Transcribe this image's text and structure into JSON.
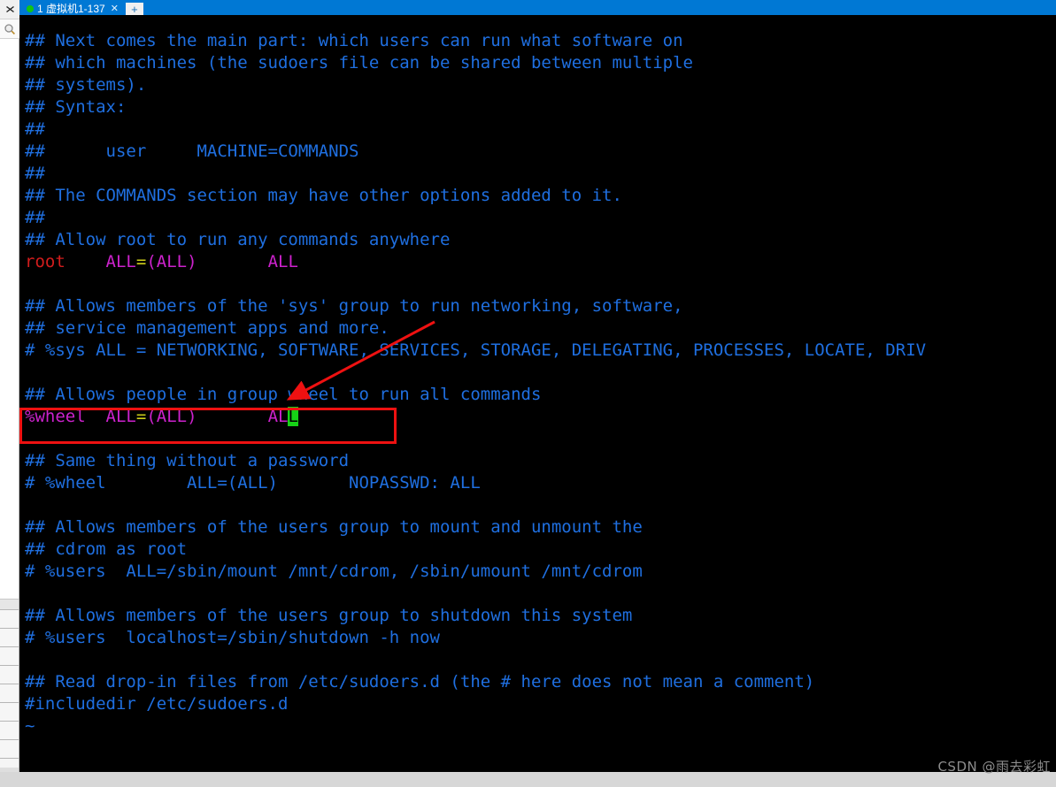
{
  "window": {
    "tab": {
      "title": "1 虚拟机1-137",
      "close_label": "✕",
      "status_dot_color": "#13c513"
    },
    "new_tab_label": "+",
    "tabbar_color": "#0078d4"
  },
  "sidebar": {
    "close_icon_label": "✕",
    "search_icon_label": "search-icon",
    "list_rows": 8
  },
  "terminal": {
    "background": "#000000",
    "colors": {
      "comment": "#1f6fe0",
      "user": "#d21d1d",
      "alias": "#cc22cc",
      "operator": "#cfcf1a",
      "cursor_bg": "#16d216"
    },
    "lines": [
      {
        "id": "l01",
        "segments": [
          {
            "t": "## Next comes the main part: which users can run what software on",
            "c": "comment"
          }
        ]
      },
      {
        "id": "l02",
        "segments": [
          {
            "t": "## which machines (the sudoers file can be shared between multiple",
            "c": "comment"
          }
        ]
      },
      {
        "id": "l03",
        "segments": [
          {
            "t": "## systems).",
            "c": "comment"
          }
        ]
      },
      {
        "id": "l04",
        "segments": [
          {
            "t": "## Syntax:",
            "c": "comment"
          }
        ]
      },
      {
        "id": "l05",
        "segments": [
          {
            "t": "##",
            "c": "comment"
          }
        ]
      },
      {
        "id": "l06",
        "segments": [
          {
            "t": "##      user     MACHINE=COMMANDS",
            "c": "comment"
          }
        ]
      },
      {
        "id": "l07",
        "segments": [
          {
            "t": "##",
            "c": "comment"
          }
        ]
      },
      {
        "id": "l08",
        "segments": [
          {
            "t": "## The COMMANDS section may have other options added to it.",
            "c": "comment"
          }
        ]
      },
      {
        "id": "l09",
        "segments": [
          {
            "t": "##",
            "c": "comment"
          }
        ]
      },
      {
        "id": "l10",
        "segments": [
          {
            "t": "## Allow root to run any commands anywhere",
            "c": "comment"
          }
        ]
      },
      {
        "id": "l11",
        "segments": [
          {
            "t": "root",
            "c": "user"
          },
          {
            "t": "    ",
            "c": "plain"
          },
          {
            "t": "ALL",
            "c": "alias"
          },
          {
            "t": "=",
            "c": "operator"
          },
          {
            "t": "(ALL)",
            "c": "alias"
          },
          {
            "t": "       ",
            "c": "plain"
          },
          {
            "t": "ALL",
            "c": "alias"
          }
        ]
      },
      {
        "id": "l12",
        "segments": [
          {
            "t": "",
            "c": "plain"
          }
        ]
      },
      {
        "id": "l13",
        "segments": [
          {
            "t": "## Allows members of the 'sys' group to run networking, software,",
            "c": "comment"
          }
        ]
      },
      {
        "id": "l14",
        "segments": [
          {
            "t": "## service management apps and more.",
            "c": "comment"
          }
        ]
      },
      {
        "id": "l15",
        "segments": [
          {
            "t": "# %sys ALL = NETWORKING, SOFTWARE, SERVICES, STORAGE, DELEGATING, PROCESSES, LOCATE, DRIV",
            "c": "comment"
          }
        ]
      },
      {
        "id": "l16",
        "segments": [
          {
            "t": "",
            "c": "plain"
          }
        ]
      },
      {
        "id": "l17",
        "segments": [
          {
            "t": "## Allows people in group wheel to run all commands",
            "c": "comment"
          }
        ]
      },
      {
        "id": "l18",
        "segments": [
          {
            "t": "%wheel",
            "c": "alias"
          },
          {
            "t": "  ",
            "c": "plain"
          },
          {
            "t": "ALL",
            "c": "alias"
          },
          {
            "t": "=",
            "c": "operator"
          },
          {
            "t": "(ALL)",
            "c": "alias"
          },
          {
            "t": "       ",
            "c": "plain"
          },
          {
            "t": "AL",
            "c": "alias"
          },
          {
            "t": "L",
            "c": "cursor"
          }
        ]
      },
      {
        "id": "l19",
        "segments": [
          {
            "t": "",
            "c": "plain"
          }
        ]
      },
      {
        "id": "l20",
        "segments": [
          {
            "t": "## Same thing without a password",
            "c": "comment"
          }
        ]
      },
      {
        "id": "l21",
        "segments": [
          {
            "t": "# %wheel        ALL=(ALL)       NOPASSWD: ALL",
            "c": "comment"
          }
        ]
      },
      {
        "id": "l22",
        "segments": [
          {
            "t": "",
            "c": "plain"
          }
        ]
      },
      {
        "id": "l23",
        "segments": [
          {
            "t": "## Allows members of the users group to mount and unmount the",
            "c": "comment"
          }
        ]
      },
      {
        "id": "l24",
        "segments": [
          {
            "t": "## cdrom as root",
            "c": "comment"
          }
        ]
      },
      {
        "id": "l25",
        "segments": [
          {
            "t": "# %users  ALL=/sbin/mount /mnt/cdrom, /sbin/umount /mnt/cdrom",
            "c": "comment"
          }
        ]
      },
      {
        "id": "l26",
        "segments": [
          {
            "t": "",
            "c": "plain"
          }
        ]
      },
      {
        "id": "l27",
        "segments": [
          {
            "t": "## Allows members of the users group to shutdown this system",
            "c": "comment"
          }
        ]
      },
      {
        "id": "l28",
        "segments": [
          {
            "t": "# %users  localhost=/sbin/shutdown -h now",
            "c": "comment"
          }
        ]
      },
      {
        "id": "l29",
        "segments": [
          {
            "t": "",
            "c": "plain"
          }
        ]
      },
      {
        "id": "l30",
        "segments": [
          {
            "t": "## Read drop-in files from /etc/sudoers.d (the # here does not mean a comment)",
            "c": "comment"
          }
        ]
      },
      {
        "id": "l31",
        "segments": [
          {
            "t": "#includedir /etc/sudoers.d",
            "c": "comment"
          }
        ]
      },
      {
        "id": "l32",
        "segments": [
          {
            "t": "~",
            "c": "comment"
          }
        ]
      }
    ]
  },
  "annotations": {
    "highlight_box": {
      "name": "wheel-line-highlight-box",
      "color": "#ee1111",
      "target_text": "%wheel  ALL=(ALL)       ALL"
    },
    "arrow": {
      "name": "pointer-arrow",
      "color": "#ee1111"
    }
  },
  "watermark": {
    "text": "CSDN @雨去彩虹"
  }
}
